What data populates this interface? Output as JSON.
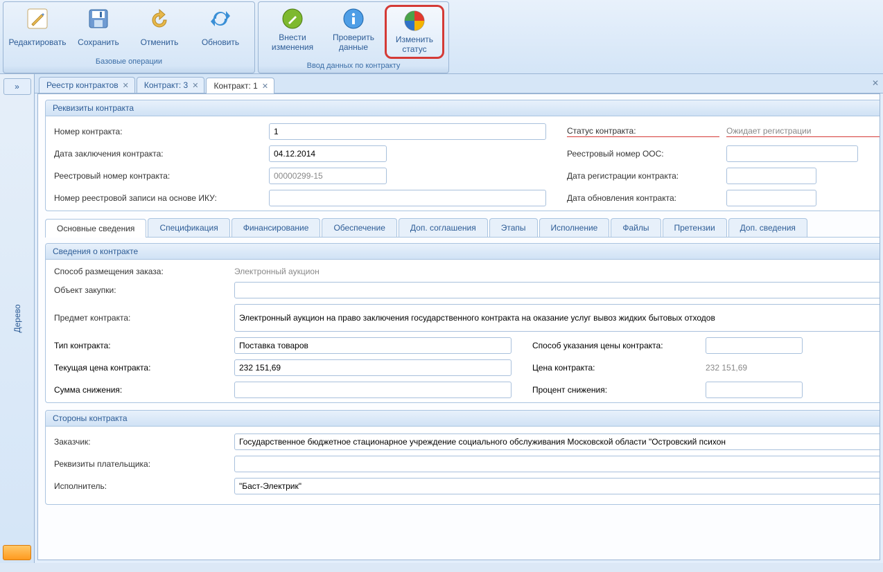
{
  "ribbon": {
    "group1_label": "Базовые операции",
    "group2_label": "Ввод данных по контракту",
    "edit": "Редактировать",
    "save": "Сохранить",
    "cancel": "Отменить",
    "refresh": "Обновить",
    "make_changes": "Внести\nизменения",
    "check_data": "Проверить\nданные",
    "change_status": "Изменить\nстатус"
  },
  "sidebar": {
    "expand_glyph": "»",
    "tree_label": "Дерево"
  },
  "tabs": {
    "t0": "Реестр контрактов",
    "t1": "Контракт: 3",
    "t2": "Контракт: 1"
  },
  "requisites": {
    "title": "Реквизиты контракта",
    "contract_no_label": "Номер контракта:",
    "contract_no": "1",
    "status_label": "Статус контракта:",
    "status_value": "Ожидает регистрации",
    "date_label": "Дата заключения контракта:",
    "date_value": "04.12.2014",
    "oos_label": "Реестровый номер ООС:",
    "oos_value": "",
    "reg_no_label": "Реестровый номер контракта:",
    "reg_no_value": "00000299-15",
    "reg_date_label": "Дата регистрации контракта:",
    "reg_date_value": "",
    "iku_label": "Номер реестровой записи на основе ИКУ:",
    "iku_value": "",
    "upd_label": "Дата обновления контракта:",
    "upd_value": ""
  },
  "inner_tabs": {
    "t0": "Основные сведения",
    "t1": "Спецификация",
    "t2": "Финансирование",
    "t3": "Обеспечение",
    "t4": "Доп. соглашения",
    "t5": "Этапы",
    "t6": "Исполнение",
    "t7": "Файлы",
    "t8": "Претензии",
    "t9": "Доп. сведения"
  },
  "contract_info": {
    "title": "Сведения о контракте",
    "placement_label": "Способ размещения заказа:",
    "placement_value": "Электронный аукцион",
    "object_label": "Объект закупки:",
    "object_value": "",
    "subject_label": "Предмет контракта:",
    "subject_value": "Электронный аукцион на право заключения государственного контракта на оказание услуг вывоз жидких бытовых отходов",
    "type_label": "Тип контракта:",
    "type_value": "Поставка товаров",
    "price_mode_label": "Способ указания цены контракта:",
    "price_mode_value": "",
    "cur_price_label": "Текущая цена контракта:",
    "cur_price_value": "232 151,69",
    "price_label": "Цена контракта:",
    "price_value": "232 151,69",
    "discount_sum_label": "Сумма снижения:",
    "discount_sum_value": "",
    "discount_pct_label": "Процент снижения:",
    "discount_pct_value": ""
  },
  "sides": {
    "title": "Стороны контракта",
    "customer_label": "Заказчик:",
    "customer_value": "Государственное бюджетное стационарное учреждение социального обслуживания Московской области \"Островский психон",
    "payer_label": "Реквизиты плательщика:",
    "payer_value": "",
    "executor_label": "Исполнитель:",
    "executor_value": "\"Баст-Электрик\""
  }
}
